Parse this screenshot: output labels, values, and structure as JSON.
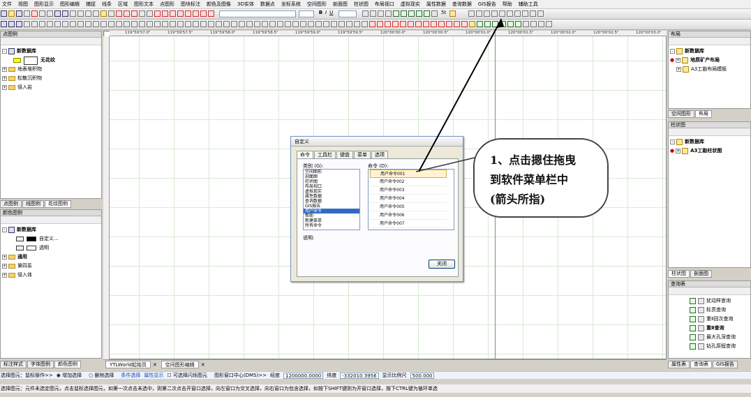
{
  "menu": [
    "文件",
    "视图",
    "图形显示",
    "图形编辑",
    "捕捉",
    "线条",
    "区域",
    "图形文本",
    "点图形",
    "图块标注",
    "颜色及图像",
    "3D实体",
    "数据点",
    "坐标系统",
    "空间图形",
    "剖面图",
    "柱状图",
    "布局视口",
    "虚拟现实",
    "属性数据",
    "查询数据",
    "GIS报告",
    "帮助",
    "辅助工具"
  ],
  "left_top_panel": {
    "title": "点图例",
    "root": "新数据库",
    "items": [
      "无花纹",
      "地表堆积物",
      "松散沉积物",
      "侵入岩"
    ],
    "tabs": [
      "点图例",
      "线图例",
      "花纹图例"
    ]
  },
  "left_bottom_panel": {
    "title": "颜色图例",
    "root": "新数据库",
    "items": [
      "自定义...",
      "透明",
      "通用",
      "第四系",
      "侵入体"
    ],
    "tabs": [
      "标注样式",
      "字体图例",
      "颜色图例"
    ]
  },
  "ruler_labels": [
    "119°59'57.0\"",
    "119°59'57.5\"",
    "119°59'58.0\"",
    "119°59'58.5\"",
    "119°59'59.0\"",
    "119°59'59.5\"",
    "120°00'00.0\"",
    "120°00'00.5\"",
    "120°00'01.0\"",
    "120°00'01.5\"",
    "120°00'02.0\"",
    "120°00'02.5\"",
    "120°00'03.0\""
  ],
  "dialog": {
    "title": "自定义",
    "tabs": [
      "命令",
      "工具栏",
      "键盘",
      "菜单",
      "选项"
    ],
    "category_label": "类别 (G):",
    "categories": [
      "空间图形",
      "剖面图",
      "柱状图",
      "布局视口",
      "虚拟现实",
      "属性数据",
      "查询数据",
      "GIS报告",
      "用户命令",
      "帮助",
      "新建菜单",
      "所有命令"
    ],
    "selected_category": "用户命令",
    "command_label": "命令 (D):",
    "commands": [
      "用户命令001",
      "用户命令002",
      "用户命令003",
      "用户命令004",
      "用户命令005",
      "用户命令006",
      "用户命令007"
    ],
    "desc_label": "说明:",
    "close_button": "关闭"
  },
  "callout": {
    "line1": "1、点击摁住拖曳",
    "line2": "到软件菜单栏中",
    "line3": "(箭头所指)"
  },
  "right_panels": {
    "layout_title": "布局",
    "layout_root": "新数据库",
    "layout_items": [
      "地质矿产布局",
      "A3工勘布局模板"
    ],
    "layout_tabs": [
      "空间图形",
      "布局"
    ],
    "column_title": "柱状图",
    "column_root": "新数据库",
    "column_items": [
      "A3工勘柱状图"
    ],
    "column_tabs": [
      "柱状图",
      "剖面图"
    ],
    "query_title": "查询表",
    "query_items": [
      "扰动样查询",
      "标贯查询",
      "重Ⅱ回次查询",
      "重Ⅱ查询",
      "最大孔深查询",
      "钻孔原程查询"
    ],
    "query_tabs": [
      "属性表",
      "查询表",
      "GIS报告"
    ]
  },
  "doc_tabs": [
    "YTLWorld起始页",
    "空间图形编辑"
  ],
  "status": {
    "label": "选择图元：鼠标操作>>",
    "opt1": "增加选择",
    "opt2": "删除选择",
    "link1": "条件选择",
    "link2": "属性显示",
    "check": "可选择闪烁图元",
    "center_label": "图形窗口中心(DMS)>>",
    "lon_label": "经度",
    "lon": "1200000.0000",
    "lat_label": "纬度",
    "lat": "-332010.3956",
    "scale_label": "显示比例尺",
    "scale": "500.000"
  },
  "hint": "选择图元：元件未选定图元，点击鼠标选择图元，如第一次点击未选中，则第二次点击开窗口选择，向左窗口为交叉选择，向右窗口为包含选择，如按下SHIFT键则为开窗口选择，按下CTRL键为循环单选",
  "toolbar": {
    "zoom": "5t"
  },
  "colors": {
    "accent": "#316ac5",
    "grid": "#d6ead2"
  }
}
